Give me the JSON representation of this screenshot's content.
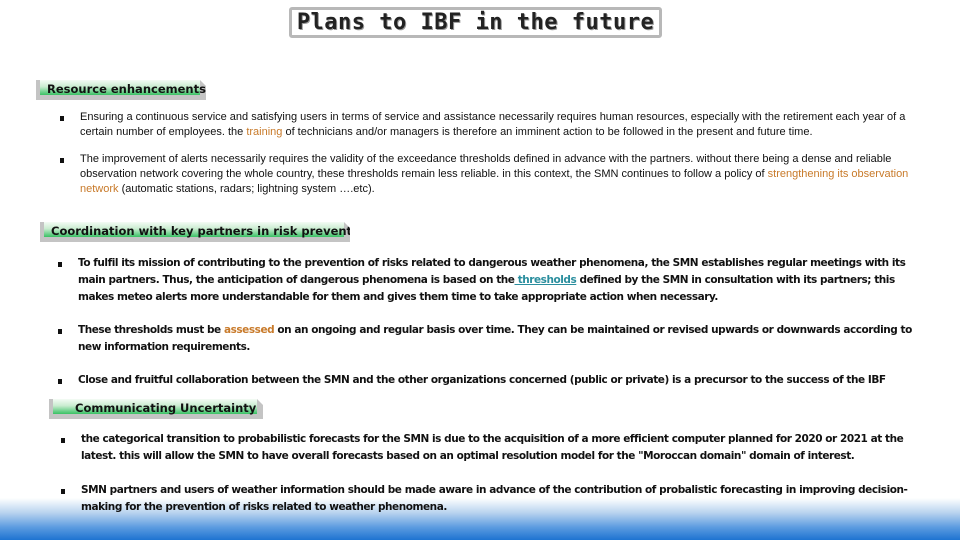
{
  "title": "Plans to IBF in the future",
  "colors": {
    "highlight_orange": "#c87a2a",
    "link_teal": "#2a8e9e",
    "header_green": "#39c164",
    "footer_blue": "#1e73d1"
  },
  "sections": [
    {
      "header": "Resource  enhancements",
      "bullets": [
        {
          "before": "Ensuring a continuous service and satisfying users in terms of service and assistance necessarily requires human resources, especially with the retirement each year of a certain number of employees. the ",
          "highlight": "training",
          "after": " of technicians and/or managers is therefore an imminent action to be followed in the present and future time."
        },
        {
          "before": "The improvement of alerts necessarily requires the validity of the exceedance thresholds defined in advance with the partners. without there being a dense and reliable observation network covering the whole country, these thresholds remain less reliable. in this context, the SMN continues to follow a policy of ",
          "highlight": "strengthening its observation network",
          "after": " (automatic stations, radars; lightning system ….etc)."
        }
      ]
    },
    {
      "header": "Coordination with key partners in risk prevention",
      "bullets": [
        {
          "before": "To fulfil its mission of contributing to the prevention of risks related to dangerous weather phenomena, the SMN establishes regular meetings with its main partners. Thus, the anticipation of dangerous phenomena is based on the",
          "highlight": " thresholds",
          "after": " defined by the SMN in consultation with its partners; this makes meteo alerts more understandable for them and gives them time to take appropriate action when necessary."
        },
        {
          "before": "These thresholds must be ",
          "highlight": "assessed",
          "after": " on an ongoing and regular basis over time. They can be maintained or revised upwards or downwards according to new information requirements."
        },
        {
          "before": "Close and fruitful collaboration between the SMN and the other organizations concerned (public or private) is a precursor to the success of the IBF",
          "highlight": "",
          "after": ""
        }
      ]
    },
    {
      "header": "Communicating Uncertainty",
      "bullets": [
        {
          "before": "the categorical transition to probabilistic forecasts for the SMN is due to the acquisition of a more efficient computer planned for 2020 or 2021 at the latest. this will allow the SMN to have overall forecasts based on an optimal resolution model for the \"Moroccan domain\" domain of interest.",
          "highlight": "",
          "after": ""
        },
        {
          "before": "SMN partners and users of weather information should be made aware in advance of the contribution of probalistic forecasting in improving decision-making for the prevention of risks related to weather phenomena.",
          "highlight": "",
          "after": ""
        }
      ]
    }
  ]
}
